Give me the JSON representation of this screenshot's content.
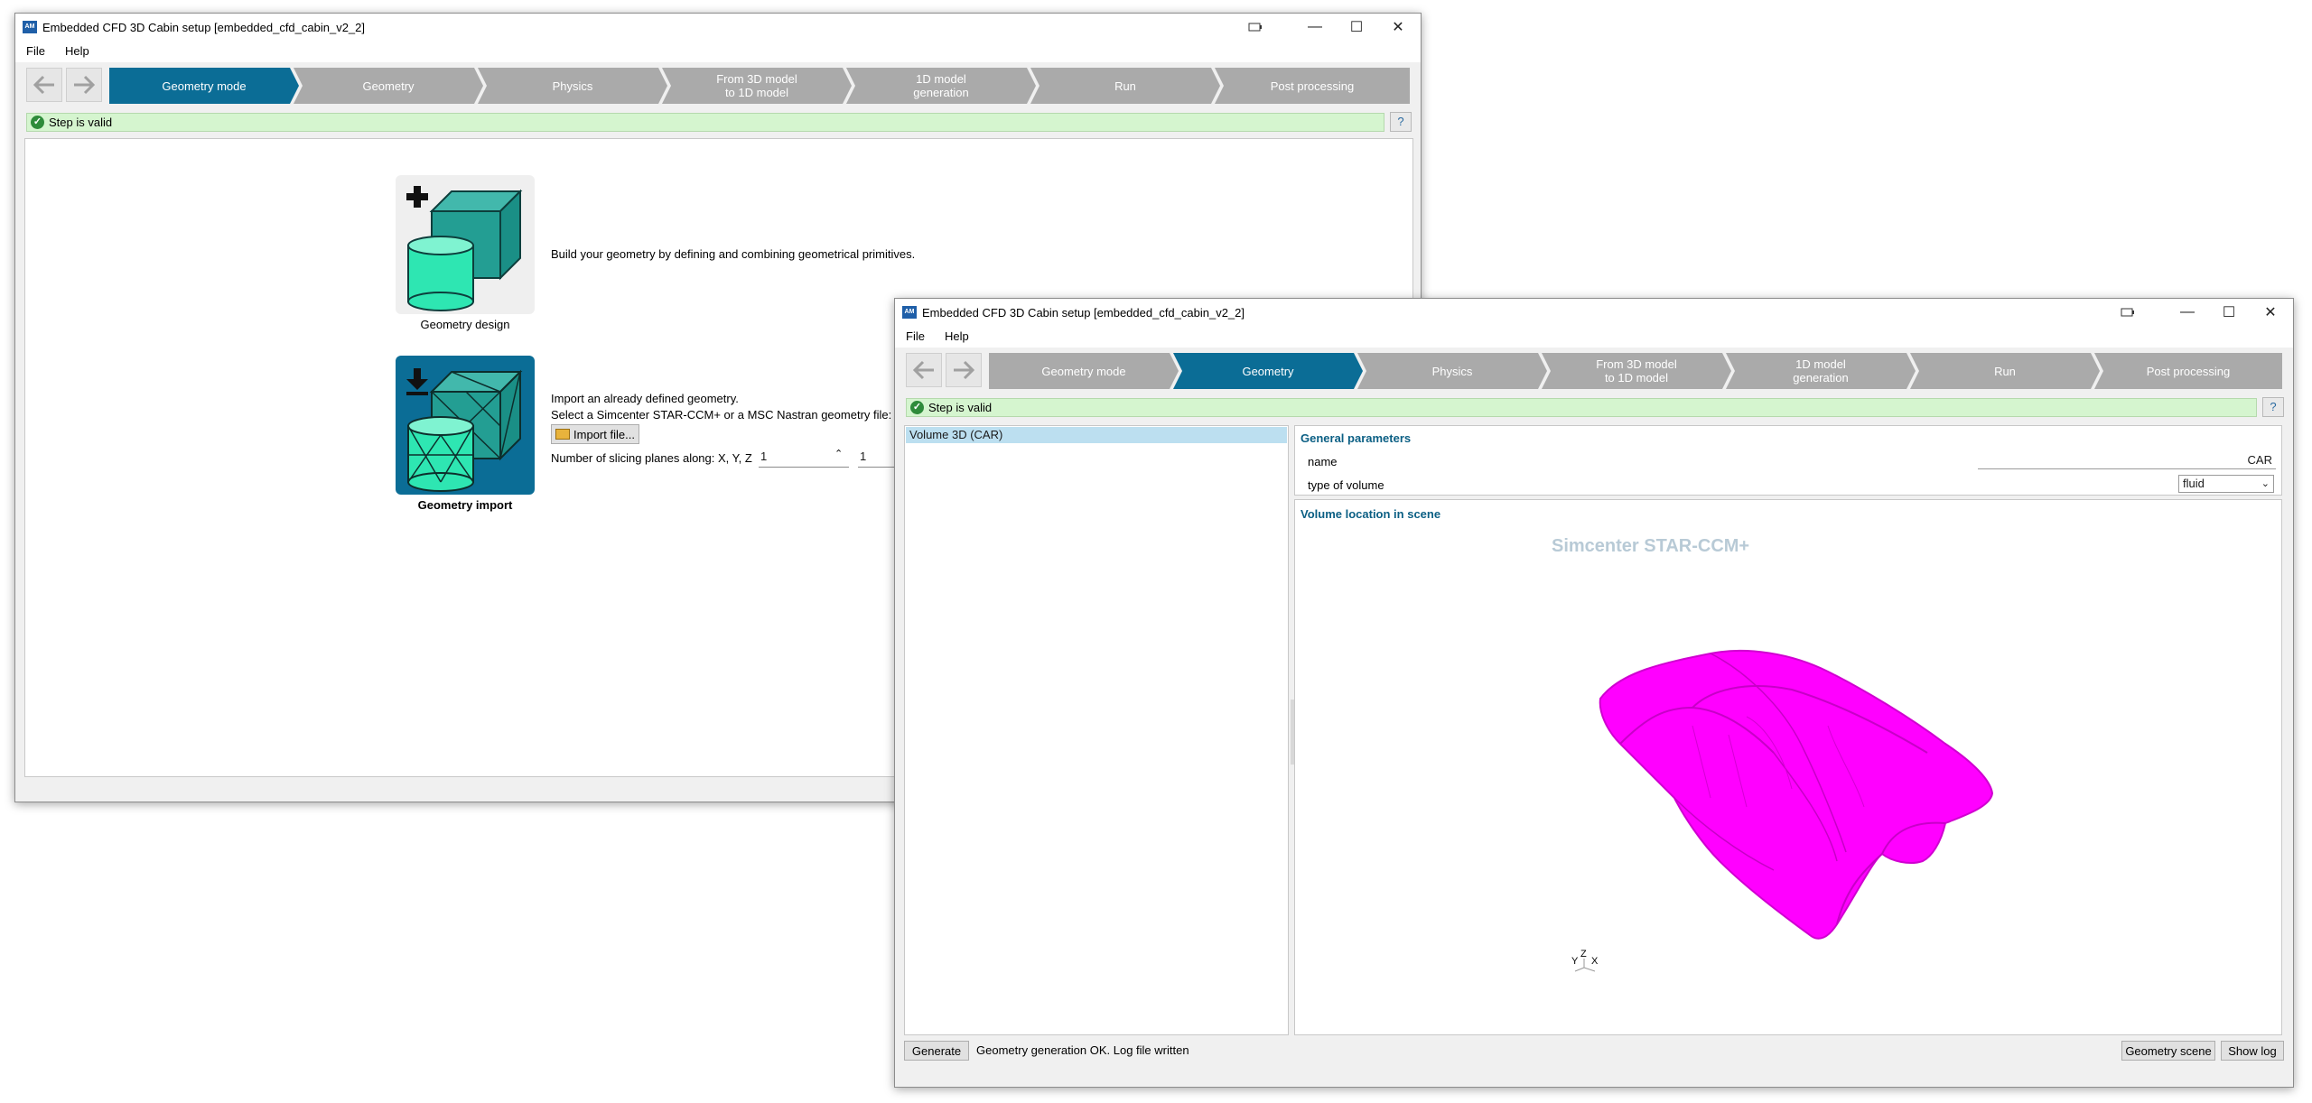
{
  "window1": {
    "title": "Embedded CFD 3D Cabin setup [embedded_cfd_cabin_v2_2]",
    "menu": [
      "File",
      "Help"
    ],
    "steps": [
      "Geometry mode",
      "Geometry",
      "Physics",
      "From 3D model\nto 1D model",
      "1D model\ngeneration",
      "Run",
      "Post processing"
    ],
    "status": "Step is valid",
    "help": "?",
    "design_caption": "Geometry design",
    "design_text": "Build your geometry by defining and combining geometrical primitives.",
    "import_caption": "Geometry import",
    "import_text1": "Import an already defined geometry.",
    "import_text2": "Select a Simcenter STAR-CCM+ or a MSC Nastran geometry file:",
    "import_button": "Import file...",
    "slicing_label": "Number of slicing planes along: X, Y, Z",
    "slicing_x": "1",
    "slicing_y": "1"
  },
  "window2": {
    "title": "Embedded CFD 3D Cabin setup [embedded_cfd_cabin_v2_2]",
    "menu": [
      "File",
      "Help"
    ],
    "steps": [
      "Geometry mode",
      "Geometry",
      "Physics",
      "From 3D model\nto 1D model",
      "1D model\ngeneration",
      "Run",
      "Post processing"
    ],
    "status": "Step is valid",
    "help": "?",
    "tree_item": "Volume 3D (CAR)",
    "general_title": "General parameters",
    "name_label": "name",
    "name_value": "CAR",
    "type_label": "type of volume",
    "type_value": "fluid",
    "location_title": "Volume location in scene",
    "watermark": "Simcenter STAR-CCM+",
    "axes": [
      "Y",
      "Z",
      "X"
    ],
    "generate_button": "Generate",
    "generate_status": "Geometry generation OK. Log file written",
    "scene_button": "Geometry scene",
    "log_button": "Show log"
  },
  "colors": {
    "step_active": "#0b6d96",
    "step_inactive": "#aaaaaa",
    "status_ok": "#d5f5cf",
    "model": "#ff00ff"
  }
}
